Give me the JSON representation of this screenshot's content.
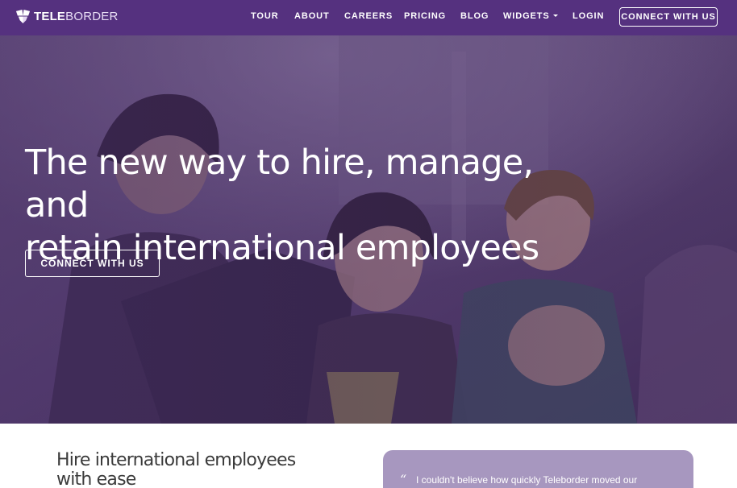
{
  "brand": {
    "name_bold": "TELE",
    "name_light": "BORDER",
    "logo_icon": "teleborder-logo-icon"
  },
  "nav": {
    "items": [
      {
        "label": "TOUR"
      },
      {
        "label": "ABOUT"
      },
      {
        "label": "CAREERS"
      },
      {
        "label": "PRICING"
      },
      {
        "label": "BLOG"
      },
      {
        "label": "WIDGETS"
      },
      {
        "label": "LOGIN"
      }
    ],
    "widgets_dropdown_icon": "caret-down-icon",
    "cta_label": "CONNECT WITH US"
  },
  "hero": {
    "title_line1": "The new way to hire, manage, and",
    "title_line2": "retain international employees",
    "cta_label": "CONNECT WITH US"
  },
  "section": {
    "heading_line1": "Hire international employees",
    "heading_line2": "with ease"
  },
  "testimonial": {
    "quote_icon": "quote-icon",
    "quote_mark": "“",
    "text": "I couldn't believe how quickly Teleborder moved our"
  },
  "colors": {
    "nav_background": "#55317f",
    "hero_overlay": "#4a3263",
    "testimonial_background": "#a797bf"
  }
}
